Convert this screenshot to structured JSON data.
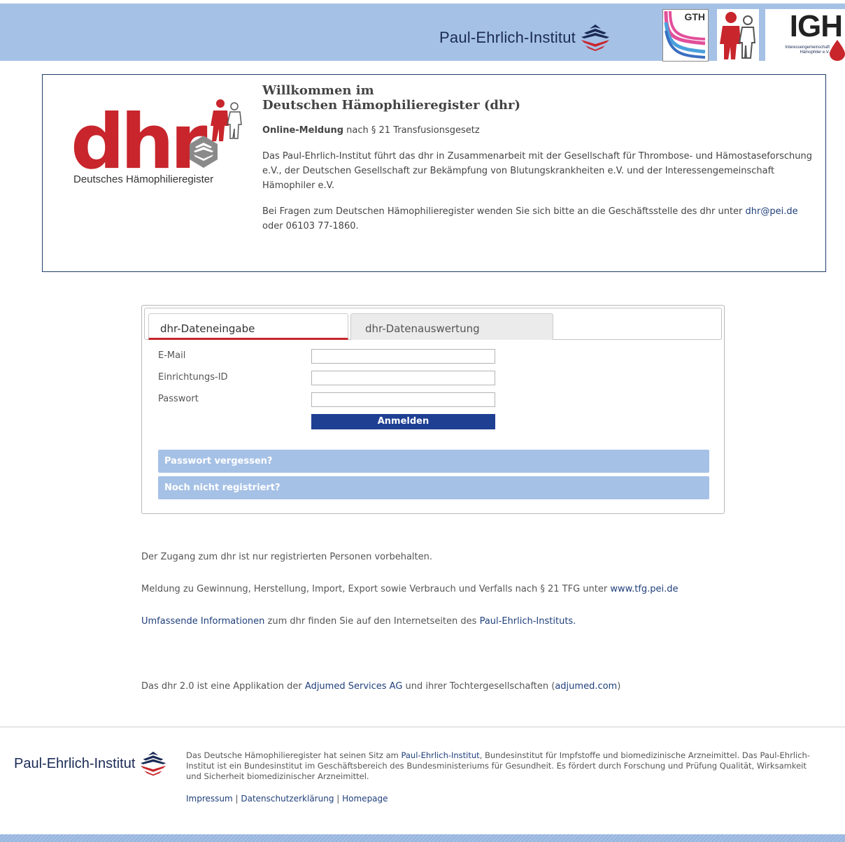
{
  "header": {
    "pei_name": "Paul-Ehrlich-Institut",
    "gth_label": "GTH",
    "igh_label": "IGH",
    "igh_sub": "Interessengemeinschaft Hämophiler e.V."
  },
  "welcome": {
    "logo_text": "dhr",
    "logo_sub": "Deutsches Hämophilieregister",
    "title_line1": "Willkommen im",
    "title_line2": "Deutschen Hämophilieregister (dhr)",
    "online_bold": "Online-Meldung",
    "online_rest": " nach § 21 Transfusionsgesetz",
    "paragraph1": "Das Paul-Ehrlich-Institut führt das dhr in Zusammenarbeit mit der Gesellschaft für Thrombose- und Hämostaseforschung e.V., der Deutschen Gesellschaft zur Bekämpfung von Blutungskrankheiten e.V. und der Interessengemeinschaft Hämophiler e.V.",
    "paragraph2_prefix": "Bei Fragen zum Deutschen Hämophilieregister wenden Sie sich bitte an die Geschäftsstelle des dhr unter ",
    "contact_email": "dhr@pei.de",
    "paragraph2_suffix": " oder 06103 77-1860."
  },
  "login": {
    "tabs": [
      {
        "label": "dhr-Dateneingabe"
      },
      {
        "label": "dhr-Datenauswertung"
      }
    ],
    "email_label": "E-Mail",
    "email_value": "",
    "institution_label": "Einrichtungs-ID",
    "institution_value": "",
    "password_label": "Passwort",
    "password_value": "",
    "submit_label": "Anmelden",
    "forgot_label": "Passwort vergessen?",
    "register_label": "Noch nicht registriert?"
  },
  "info": {
    "access_note": "Der Zugang zum dhr ist nur registrierten Personen vorbehalten.",
    "report_prefix": "Meldung zu Gewinnung, Herstellung, Import, Export sowie Verbrauch und Verfalls nach § 21 TFG unter ",
    "report_link": "www.tfg.pei.de",
    "more_link": "Umfassende Informationen",
    "more_middle": " zum dhr finden Sie auf den Internetseiten des ",
    "pei_link": "Paul-Ehrlich-Instituts.",
    "app_prefix": "Das dhr 2.0 ist eine Applikation der ",
    "adjumed_link": "Adjumed Services AG",
    "app_middle": " und ihrer Tochtergesellschaften (",
    "adjumed_com": "adjumed.com",
    "app_suffix": ")"
  },
  "footer": {
    "pei_name": "Paul-Ehrlich-Institut",
    "text_prefix": "Das Deutsche Hämophilieregister hat seinen Sitz am ",
    "pei_link": "Paul-Ehrlich-Institut",
    "text_suffix": ", Bundesinstitut für Impfstoffe und biomedizinische Arzneimittel. Das Paul-Ehrlich-Institut ist ein Bundesinstitut im Geschäftsbereich des Bundesministeriums für Gesundheit. Es fördert durch Forschung und Prüfung Qualität, Wirksamkeit und Sicherheit biomedizinischer Arzneimittel.",
    "links": [
      {
        "label": "Impressum"
      },
      {
        "label": "Datenschutzerklärung"
      },
      {
        "label": "Homepage"
      }
    ],
    "separator": " | "
  },
  "colors": {
    "header_bg": "#a6c1e6",
    "brand_red": "#c8252c",
    "brand_navy": "#1f3f93",
    "link": "#1f3f7a"
  }
}
